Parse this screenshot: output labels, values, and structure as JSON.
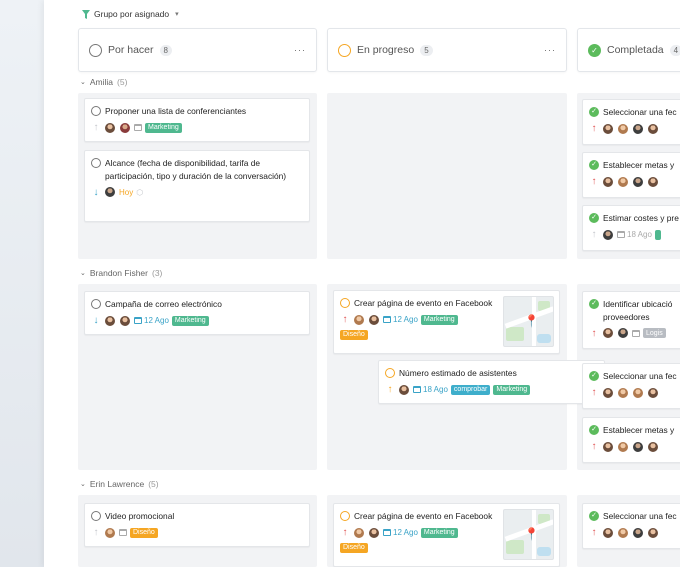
{
  "toolbar": {
    "groupby_label": "Grupo por asignado"
  },
  "columns": [
    {
      "title": "Por hacer",
      "count": "8"
    },
    {
      "title": "En progreso",
      "count": "5"
    },
    {
      "title": "Completada",
      "count": "4"
    }
  ],
  "groups": [
    {
      "name": "Amilia",
      "count": "(5)",
      "todo": [
        {
          "title": "Proponer una lista de conferenciantes",
          "tags": [
            "Marketing"
          ]
        },
        {
          "title": "Alcance (fecha de disponibilidad, tarifa de participación, tipo y duración de la conversación)",
          "due": "Hoy"
        }
      ],
      "done": [
        {
          "title": "Seleccionar una fec"
        },
        {
          "title": "Establecer metas y"
        },
        {
          "title": "Estimar costes y pre",
          "date": "18 Ago"
        }
      ]
    },
    {
      "name": "Brandon Fisher",
      "count": "(3)",
      "todo": [
        {
          "title": "Campaña de correo electrónico",
          "date": "12 Ago",
          "tags": [
            "Marketing"
          ]
        }
      ],
      "progress": [
        {
          "title": "Crear página de evento en Facebook",
          "date": "12 Ago",
          "tags": [
            "Marketing",
            "Diseño"
          ]
        },
        {
          "title": "Número estimado de asistentes",
          "date": "18 Ago",
          "tags": [
            "comprobar",
            "Marketing"
          ]
        }
      ],
      "done": [
        {
          "title": "Identificar ubicació",
          "title2": "proveedores",
          "tags": [
            "Logis"
          ]
        },
        {
          "title": "Seleccionar una fec"
        },
        {
          "title": "Establecer metas y"
        }
      ]
    },
    {
      "name": "Erin Lawrence",
      "count": "(5)",
      "todo": [
        {
          "title": "Video promocional",
          "tags": [
            "Diseño"
          ]
        }
      ],
      "progress": [
        {
          "title": "Crear página de evento en Facebook",
          "date": "12 Ago",
          "tags": [
            "Marketing",
            "Diseño"
          ]
        }
      ],
      "done": [
        {
          "title": "Seleccionar una fec"
        }
      ]
    }
  ],
  "colors": {
    "accent_green": "#4fb88f",
    "orange": "#f5a623",
    "blue": "#3eaecb",
    "done_green": "#5cbb5c"
  }
}
